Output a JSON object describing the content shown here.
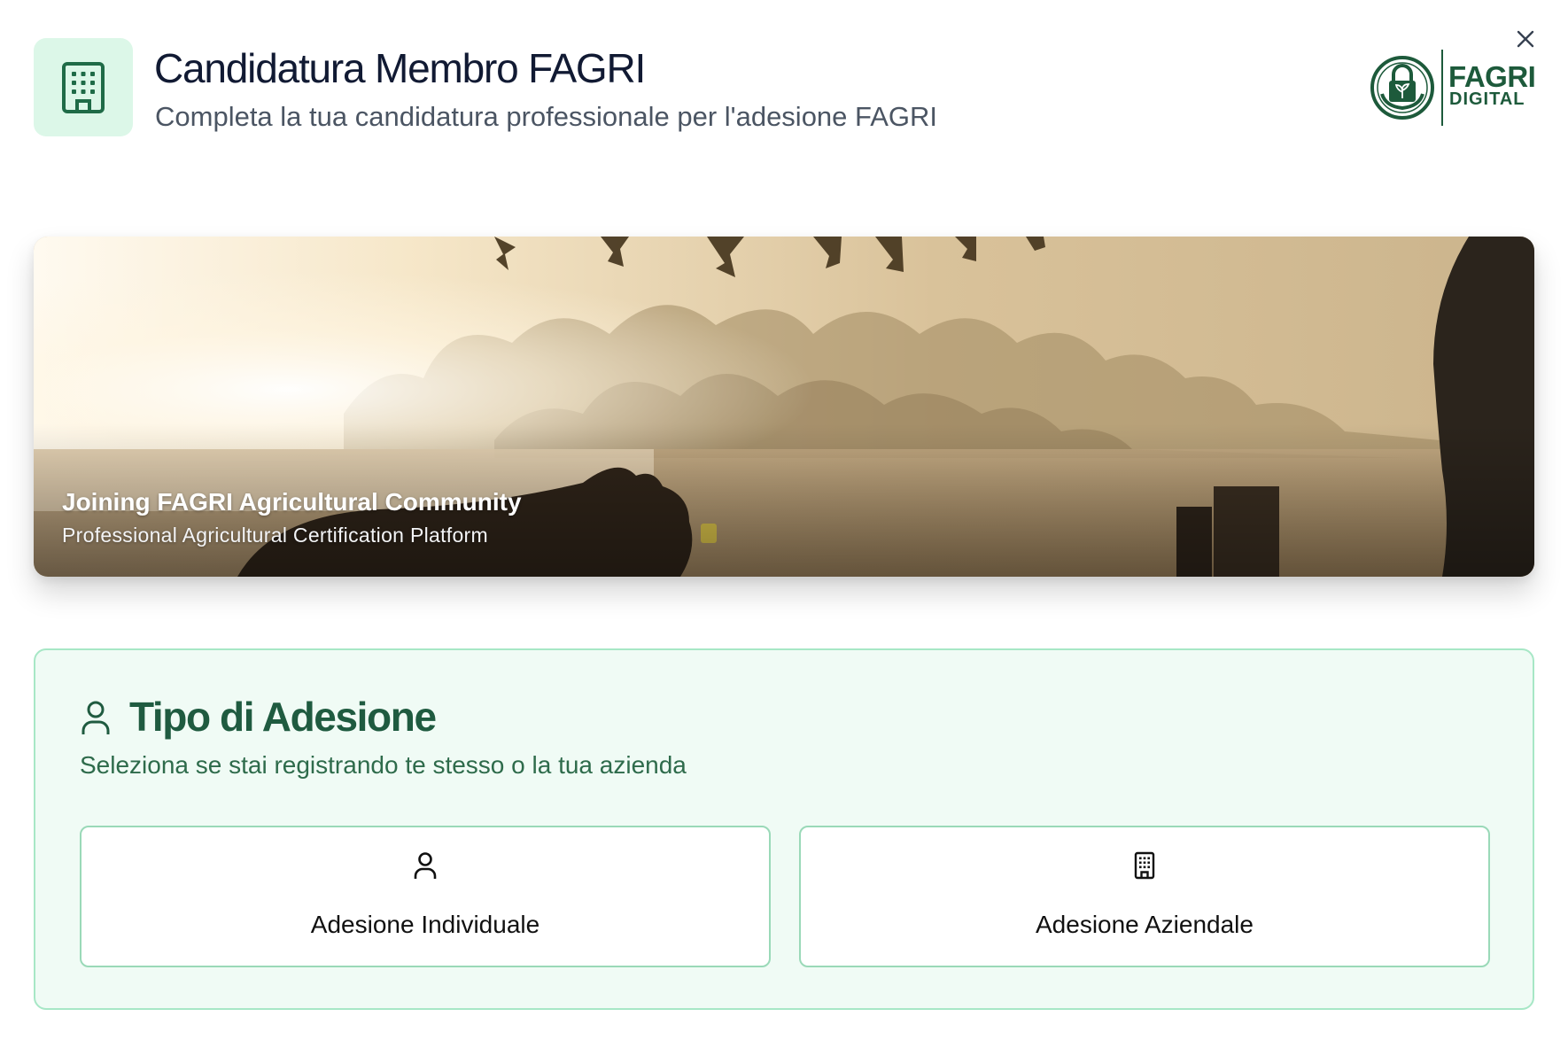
{
  "dialog": {
    "title": "Candidatura Membro FAGRI",
    "subtitle": "Completa la tua candidatura professionale per l'adesione FAGRI",
    "header_icon": "building-icon",
    "close_icon": "close-icon"
  },
  "logo": {
    "name": "FAGRI",
    "tagline": "DIGITAL",
    "emblem_icon": "lock-hands-plant-icon",
    "color": "#1d5a3b"
  },
  "hero": {
    "title": "Joining FAGRI Agricultural Community",
    "subtitle": "Professional Agricultural Certification Platform"
  },
  "membership_type": {
    "icon": "user-icon",
    "title": "Tipo di Adesione",
    "description": "Seleziona se stai registrando te stesso o la tua azienda",
    "options": [
      {
        "label": "Adesione Individuale",
        "icon": "user-icon"
      },
      {
        "label": "Adesione Aziendale",
        "icon": "building-icon"
      }
    ]
  },
  "colors": {
    "accent_green": "#1f5b40",
    "panel_background": "#f0fbf5",
    "panel_border": "#a7e7c6",
    "header_icon_background": "#dcf7e8"
  }
}
